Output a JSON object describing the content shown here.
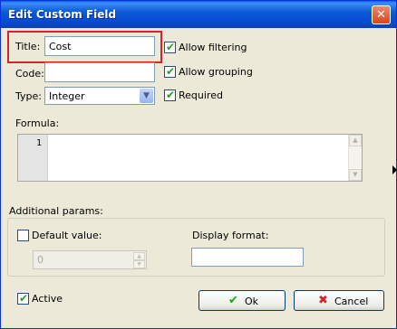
{
  "window": {
    "title": "Edit Custom Field",
    "close_glyph": "✕"
  },
  "fields": {
    "title_label": "Title:",
    "title_value": "Cost",
    "code_label": "Code:",
    "code_value": "",
    "type_label": "Type:",
    "type_value": "Integer"
  },
  "options": {
    "allow_filtering": {
      "label": "Allow filtering",
      "checked": true
    },
    "allow_grouping": {
      "label": "Allow grouping",
      "checked": true
    },
    "required": {
      "label": "Required",
      "checked": true
    }
  },
  "formula": {
    "label": "Formula:",
    "line_number": "1",
    "text": ""
  },
  "additional": {
    "label": "Additional params:",
    "default_value_label": "Default value:",
    "default_value_checked": false,
    "default_value": "0",
    "display_format_label": "Display format:",
    "display_format_value": ""
  },
  "footer": {
    "active_label": "Active",
    "active_checked": true,
    "ok_label": "Ok",
    "cancel_label": "Cancel"
  },
  "icons": {
    "check": "✔",
    "ok_icon": "check-icon",
    "cancel_icon": "cross-icon"
  },
  "colors": {
    "accent": "#0a5ce8",
    "highlight_border": "#d4242b",
    "check_green": "#21a121",
    "cancel_red": "#d4242b"
  }
}
